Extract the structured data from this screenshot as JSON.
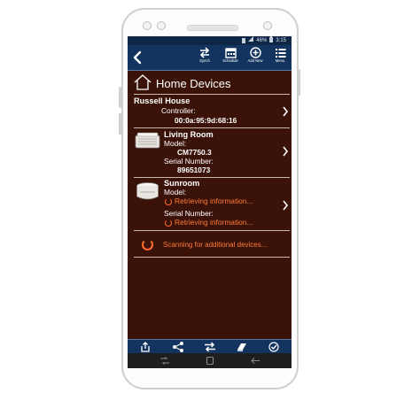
{
  "status": {
    "battery": "46%",
    "time": "3:15"
  },
  "toolbar": {
    "synch_label": "Synch",
    "schedule_label": "Schedule",
    "add_label": "Add New",
    "menu_label": "Menu"
  },
  "page": {
    "title": "Home Devices"
  },
  "controller": {
    "name": "Russell House",
    "label": "Controller:",
    "mac": "00:0a:95:9d:68:16"
  },
  "devices": [
    {
      "name": "Living Room",
      "model_label": "Model:",
      "model": "CM7750.3",
      "serial_label": "Serial Number:",
      "serial": "89651073"
    },
    {
      "name": "Sunroom",
      "model_label": "Model:",
      "model": "Retrieving information...",
      "serial_label": "Serial Number:",
      "serial": "Retrieving information..."
    }
  ],
  "scan": {
    "text": "Scanning for additional devices..."
  },
  "colors": {
    "background": "#3a1208",
    "toolbar": "#12345e",
    "accent": "#ff6a2a"
  },
  "icons": {
    "toolbar": [
      "back-arrow-icon",
      "synch-icon",
      "schedule-icon",
      "add-new-icon",
      "menu-icon"
    ],
    "bottom": [
      "share-out-icon",
      "share-icon",
      "swap-icon",
      "book-icon",
      "check-circle-icon"
    ],
    "nav": [
      "recent-apps-icon",
      "home-icon",
      "back-icon"
    ]
  }
}
